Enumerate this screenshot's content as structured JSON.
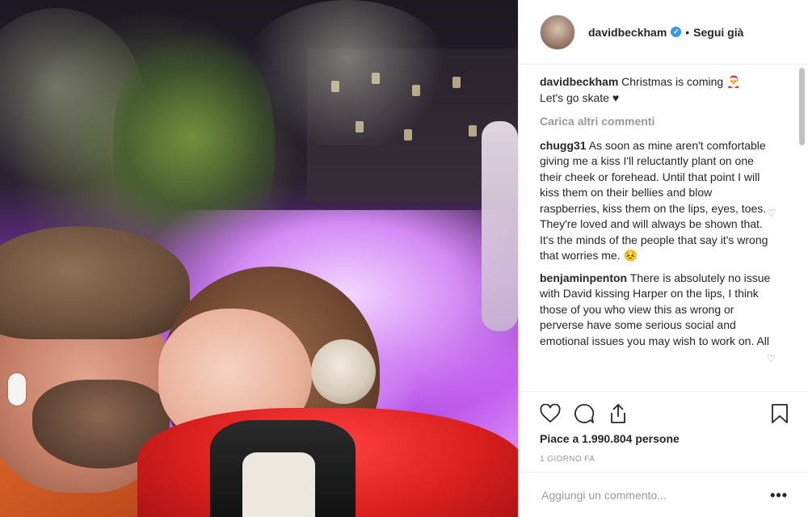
{
  "post": {
    "username": "davidbeckham",
    "follow_status": "Segui già",
    "caption_user": "davidbeckham",
    "caption_text": "Christmas is coming 🎅",
    "caption_text2": "Let's go skate ♥",
    "load_more": "Carica altri commenti",
    "likes": "Piace a 1.990.804 persone",
    "time_ago": "1 GIORNO FA",
    "add_comment_placeholder": "Aggiungi un commento...",
    "more_options": "•••"
  },
  "comments": [
    {
      "user": "chugg31",
      "text": "As soon as mine aren't comfortable giving me a kiss I'll reluctantly plant on one their cheek or forehead. Until that point I will kiss them on their bellies and blow raspberries, kiss them on the lips, eyes, toes. They're loved and will always be shown that. It's the minds of the people that say it's wrong that worries me. 😣"
    },
    {
      "user": "benjaminpenton",
      "text": "There is absolutely no issue with David kissing Harper on the lips, I think those of you who view this as wrong or perverse have some serious social and emotional issues you may wish to work on. All"
    }
  ],
  "icons": {
    "verified": "verified-badge-icon",
    "like": "heart-icon",
    "comment": "comment-bubble-icon",
    "share": "share-icon",
    "save": "bookmark-icon"
  },
  "colors": {
    "verified": "#3897f0",
    "muted": "#999999",
    "border": "#efefef",
    "text": "#262626"
  }
}
